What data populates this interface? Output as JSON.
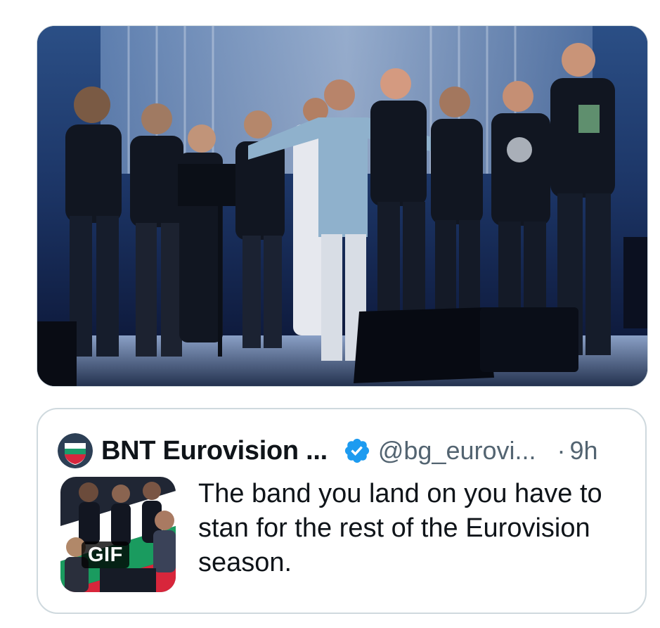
{
  "media": {
    "alt": "",
    "icon": "photo"
  },
  "quote_tweet": {
    "display_name": "BNT Eurovision ...",
    "verified_icon": "verified-badge-icon",
    "handle": "@bg_eurovi...",
    "separator": "·",
    "timestamp": "9h",
    "gif_label": "GIF",
    "text": "The band you land on you have to stan for the rest of the Eurovision season."
  },
  "colors": {
    "verified_blue": "#1d9bf0",
    "secondary_text": "#536471",
    "border": "#cfd9de"
  }
}
